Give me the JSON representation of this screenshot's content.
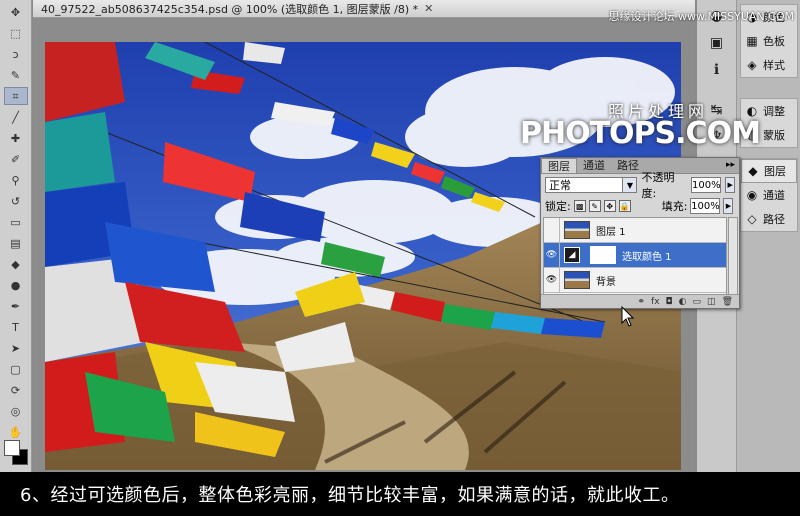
{
  "watermark_top": "思缘设计论坛 www.MISSYUAN.COM",
  "document": {
    "title": "40_97522_ab508637425c354.psd @ 100% (选取颜色 1, 图层蒙版 /8) *",
    "close_glyph": "✕"
  },
  "tools": [
    {
      "name": "move-tool-icon",
      "glyph": "✥"
    },
    {
      "name": "marquee-tool-icon",
      "glyph": "⬚"
    },
    {
      "name": "lasso-tool-icon",
      "glyph": "ↄ"
    },
    {
      "name": "quick-select-tool-icon",
      "glyph": "✎"
    },
    {
      "name": "crop-tool-icon",
      "glyph": "⌗"
    },
    {
      "name": "eyedropper-tool-icon",
      "glyph": "╱"
    },
    {
      "name": "healing-tool-icon",
      "glyph": "✚"
    },
    {
      "name": "brush-tool-icon",
      "glyph": "✐"
    },
    {
      "name": "stamp-tool-icon",
      "glyph": "⚲"
    },
    {
      "name": "history-brush-icon",
      "glyph": "↺"
    },
    {
      "name": "eraser-tool-icon",
      "glyph": "▭"
    },
    {
      "name": "gradient-tool-icon",
      "glyph": "▤"
    },
    {
      "name": "blur-tool-icon",
      "glyph": "◆"
    },
    {
      "name": "dodge-tool-icon",
      "glyph": "●"
    },
    {
      "name": "pen-tool-icon",
      "glyph": "✒"
    },
    {
      "name": "type-tool-icon",
      "glyph": "T"
    },
    {
      "name": "path-select-tool-icon",
      "glyph": "➤"
    },
    {
      "name": "shape-tool-icon",
      "glyph": "▢"
    },
    {
      "name": "3d-rotate-tool-icon",
      "glyph": "⟳"
    },
    {
      "name": "3d-orbit-tool-icon",
      "glyph": "◎"
    },
    {
      "name": "hand-tool-icon",
      "glyph": "✋"
    },
    {
      "name": "zoom-tool-icon",
      "glyph": "⚲"
    }
  ],
  "right_panel": {
    "group1": [
      {
        "name": "color-panel-item",
        "icon": "◑",
        "label": "颜色"
      },
      {
        "name": "swatches-panel-item",
        "icon": "▦",
        "label": "色板"
      },
      {
        "name": "styles-panel-item",
        "icon": "◈",
        "label": "样式"
      }
    ],
    "group2": [
      {
        "name": "adjustments-panel-item",
        "icon": "◐",
        "label": "调整"
      },
      {
        "name": "masks-panel-item",
        "icon": "◍",
        "label": "蒙版"
      }
    ],
    "group3": [
      {
        "name": "layers-panel-item",
        "icon": "◆",
        "label": "图层"
      },
      {
        "name": "channels-panel-item",
        "icon": "◉",
        "label": "通道"
      },
      {
        "name": "paths-panel-item",
        "icon": "◇",
        "label": "路径"
      }
    ],
    "side_icons": [
      "◒",
      "▣",
      "ℹ",
      "↹",
      "♆"
    ]
  },
  "logo": {
    "cn": "照片处理网",
    "en": "PHOTOPS.COM"
  },
  "layers_panel": {
    "tabs": [
      "图层",
      "通道",
      "路径"
    ],
    "tab_menu": "▸▸",
    "blend_mode": "正常",
    "opacity_label": "不透明度:",
    "opacity_value": "100%",
    "lock_label": "锁定:",
    "fill_label": "填充:",
    "fill_value": "100%",
    "layers": [
      {
        "name": "图层 1",
        "type": "pixel",
        "visible": false
      },
      {
        "name": "选取颜色 1",
        "type": "adjustment",
        "visible": true,
        "selected": true
      },
      {
        "name": "背景",
        "type": "pixel",
        "visible": true
      }
    ],
    "bottom_icons": [
      "⚭",
      "fx",
      "◘",
      "◐",
      "▭",
      "◫",
      "🗑"
    ]
  },
  "caption": "6、经过可选颜色后，整体色彩亮丽，细节比较丰富，如果满意的话，就此收工。"
}
